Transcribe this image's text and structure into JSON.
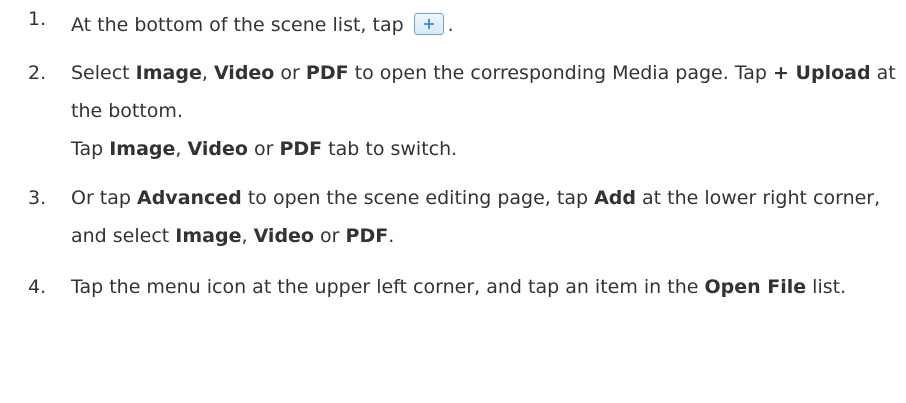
{
  "steps": [
    {
      "number": "1.",
      "text_before_icon": "At the bottom of the scene list, tap",
      "icon": "plus-add-icon",
      "text_after_icon": "."
    },
    {
      "number": "2.",
      "p1": "Select ",
      "b1": "Image",
      "p2": ", ",
      "b2": "Video",
      "p3": " or ",
      "b3": "PDF",
      "p4": " to open the corresponding Media page. Tap ",
      "b4": "+ Upload",
      "p5": " at the bottom.",
      "sub_p1": "Tap ",
      "sub_b1": "Image",
      "sub_p2": ", ",
      "sub_b2": "Video",
      "sub_p3": " or ",
      "sub_b3": "PDF",
      "sub_p4": " tab to switch."
    },
    {
      "number": "3.",
      "p1": "Or tap ",
      "b1": "Advanced",
      "p2": " to open the scene editing page, tap ",
      "b2": "Add",
      "p3": " at the lower right corner, and select ",
      "b3": "Image",
      "p4": ", ",
      "b4": "Video",
      "p5": " or ",
      "b5": "PDF",
      "p6": "."
    },
    {
      "number": "4.",
      "p1": "Tap the menu icon at the upper left corner, and tap an item in the ",
      "b1": "Open File",
      "p2": " list."
    }
  ],
  "colors": {
    "text": "#333333",
    "icon_border": "#6aa6da",
    "icon_plus": "#3a8ad4"
  }
}
